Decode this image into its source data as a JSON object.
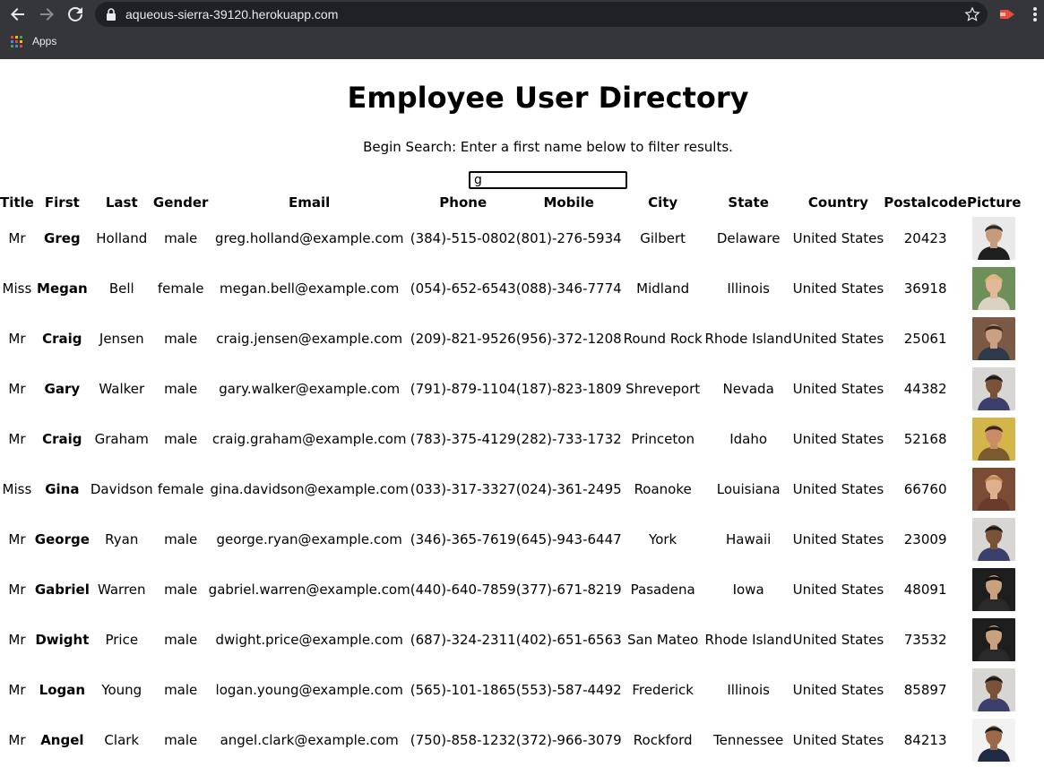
{
  "browser": {
    "url": "aqueous-sierra-39120.herokuapp.com",
    "bookmarks_apps_label": "Apps"
  },
  "page": {
    "title": "Employee User Directory",
    "instructions": "Begin Search: Enter a first name below to filter results.",
    "search_value": "g"
  },
  "table": {
    "headers": [
      "Title",
      "First",
      "Last",
      "Gender",
      "Email",
      "Phone",
      "Mobile",
      "City",
      "State",
      "Country",
      "Postalcode",
      "Picture"
    ],
    "rows": [
      {
        "title": "Mr",
        "first": "Greg",
        "last": "Holland",
        "gender": "male",
        "email": "greg.holland@example.com",
        "phone": "(384)-515-0802",
        "mobile": "(801)-276-5934",
        "city": "Gilbert",
        "state": "Delaware",
        "country": "United States",
        "postalcode": "20423",
        "avatar": {
          "bg": "#e9e9e9",
          "skin": "#c79a7c",
          "hair": "#2b2b2b",
          "shirt": "#1e1e1e"
        }
      },
      {
        "title": "Miss",
        "first": "Megan",
        "last": "Bell",
        "gender": "female",
        "email": "megan.bell@example.com",
        "phone": "(054)-652-6543",
        "mobile": "(088)-346-7774",
        "city": "Midland",
        "state": "Illinois",
        "country": "United States",
        "postalcode": "36918",
        "avatar": {
          "bg": "#6d8f5a",
          "skin": "#e3b89a",
          "hair": "#d8b778",
          "shirt": "#d9d2c2"
        }
      },
      {
        "title": "Mr",
        "first": "Craig",
        "last": "Jensen",
        "gender": "male",
        "email": "craig.jensen@example.com",
        "phone": "(209)-821-9526",
        "mobile": "(956)-372-1208",
        "city": "Round Rock",
        "state": "Rhode Island",
        "country": "United States",
        "postalcode": "25061",
        "avatar": {
          "bg": "#7b5a45",
          "skin": "#caa084",
          "hair": "#3a2a20",
          "shirt": "#2f3b4a"
        }
      },
      {
        "title": "Mr",
        "first": "Gary",
        "last": "Walker",
        "gender": "male",
        "email": "gary.walker@example.com",
        "phone": "(791)-879-1104",
        "mobile": "(187)-823-1809",
        "city": "Shreveport",
        "state": "Nevada",
        "country": "United States",
        "postalcode": "44382",
        "avatar": {
          "bg": "#d8d6d2",
          "skin": "#7a5238",
          "hair": "#1b1b1b",
          "shirt": "#3b3f6e"
        }
      },
      {
        "title": "Mr",
        "first": "Craig",
        "last": "Graham",
        "gender": "male",
        "email": "craig.graham@example.com",
        "phone": "(783)-375-4129",
        "mobile": "(282)-733-1732",
        "city": "Princeton",
        "state": "Idaho",
        "country": "United States",
        "postalcode": "52168",
        "avatar": {
          "bg": "#d4b54a",
          "skin": "#c98c66",
          "hair": "#3b2518",
          "shirt": "#7a5a2e"
        }
      },
      {
        "title": "Miss",
        "first": "Gina",
        "last": "Davidson",
        "gender": "female",
        "email": "gina.davidson@example.com",
        "phone": "(033)-317-3327",
        "mobile": "(024)-361-2495",
        "city": "Roanoke",
        "state": "Louisiana",
        "country": "United States",
        "postalcode": "66760",
        "avatar": {
          "bg": "#7a4b35",
          "skin": "#e0b08e",
          "hair": "#c28a54",
          "shirt": "#6a3a2a"
        }
      },
      {
        "title": "Mr",
        "first": "George",
        "last": "Ryan",
        "gender": "male",
        "email": "george.ryan@example.com",
        "phone": "(346)-365-7619",
        "mobile": "(645)-943-6447",
        "city": "York",
        "state": "Hawaii",
        "country": "United States",
        "postalcode": "23009",
        "avatar": {
          "bg": "#d8d6d2",
          "skin": "#7a5238",
          "hair": "#1b1b1b",
          "shirt": "#3b3f6e"
        }
      },
      {
        "title": "Mr",
        "first": "Gabriel",
        "last": "Warren",
        "gender": "male",
        "email": "gabriel.warren@example.com",
        "phone": "(440)-640-7859",
        "mobile": "(377)-671-8219",
        "city": "Pasadena",
        "state": "Iowa",
        "country": "United States",
        "postalcode": "48091",
        "avatar": {
          "bg": "#1e1e1e",
          "skin": "#c9a07e",
          "hair": "#111111",
          "shirt": "#2a2a2a"
        }
      },
      {
        "title": "Mr",
        "first": "Dwight",
        "last": "Price",
        "gender": "male",
        "email": "dwight.price@example.com",
        "phone": "(687)-324-2311",
        "mobile": "(402)-651-6563",
        "city": "San Mateo",
        "state": "Rhode Island",
        "country": "United States",
        "postalcode": "73532",
        "avatar": {
          "bg": "#1e1e1e",
          "skin": "#c9a07e",
          "hair": "#111111",
          "shirt": "#2a2a2a"
        }
      },
      {
        "title": "Mr",
        "first": "Logan",
        "last": "Young",
        "gender": "male",
        "email": "logan.young@example.com",
        "phone": "(565)-101-1865",
        "mobile": "(553)-587-4492",
        "city": "Frederick",
        "state": "Illinois",
        "country": "United States",
        "postalcode": "85897",
        "avatar": {
          "bg": "#d8d6d2",
          "skin": "#7a5238",
          "hair": "#1b1b1b",
          "shirt": "#3b3f6e"
        }
      },
      {
        "title": "Mr",
        "first": "Angel",
        "last": "Clark",
        "gender": "male",
        "email": "angel.clark@example.com",
        "phone": "(750)-858-1232",
        "mobile": "(372)-966-3079",
        "city": "Rockford",
        "state": "Tennessee",
        "country": "United States",
        "postalcode": "84213",
        "avatar": {
          "bg": "#f2f2f2",
          "skin": "#9a6a4a",
          "hair": "#1a1a1a",
          "shirt": "#1f2a44"
        }
      }
    ]
  }
}
